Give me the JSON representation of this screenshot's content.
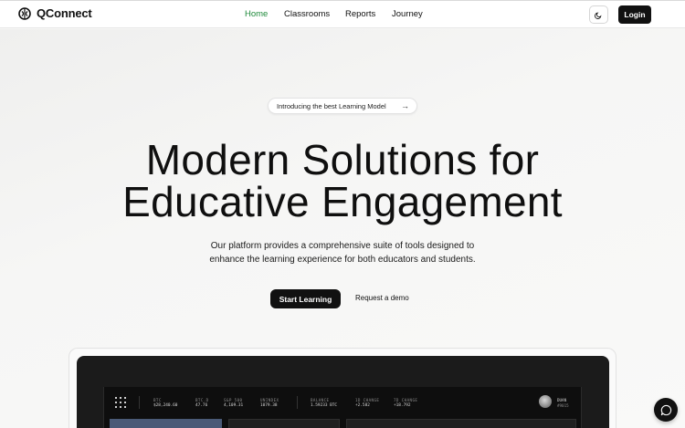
{
  "brand": {
    "name": "QConnect",
    "icon": "brain-circle-icon"
  },
  "nav": {
    "links": [
      {
        "label": "Home",
        "active": true
      },
      {
        "label": "Classrooms",
        "active": false
      },
      {
        "label": "Reports",
        "active": false
      },
      {
        "label": "Journey",
        "active": false
      }
    ],
    "theme_toggle_icon": "moon-icon",
    "login_label": "Login"
  },
  "hero": {
    "announcement": "Introducing the best Learning Model",
    "announcement_icon": "arrow-right-icon",
    "title_line1": "Modern Solutions for",
    "title_line2": "Educative Engagement",
    "subtitle_line1": "Our platform provides a comprehensive suite of tools designed to",
    "subtitle_line2": "enhance the learning experience for both educators and students.",
    "primary_cta": "Start Learning",
    "secondary_cta": "Request a demo"
  },
  "preview": {
    "tickers": [
      {
        "label": "BTC",
        "value": "$28,240.60"
      },
      {
        "label": "BTC.D",
        "value": "47.76"
      },
      {
        "label": "S&P 500",
        "value": "4,109.31"
      },
      {
        "label": "UNINDEX",
        "value": "1079.38"
      },
      {
        "label": "BALANCE",
        "value": "1.59233 BTC"
      },
      {
        "label": "1D CHANGE",
        "value": "+2.582"
      },
      {
        "label": "7D CHANGE",
        "value": "+18.792"
      }
    ],
    "user": {
      "name": "DUAN",
      "id": "#9015"
    }
  },
  "colors": {
    "accent": "#1f8a3b",
    "dark": "#111111",
    "card_blue": "#4a5a77"
  },
  "chat_icon": "chat-bubble-icon"
}
